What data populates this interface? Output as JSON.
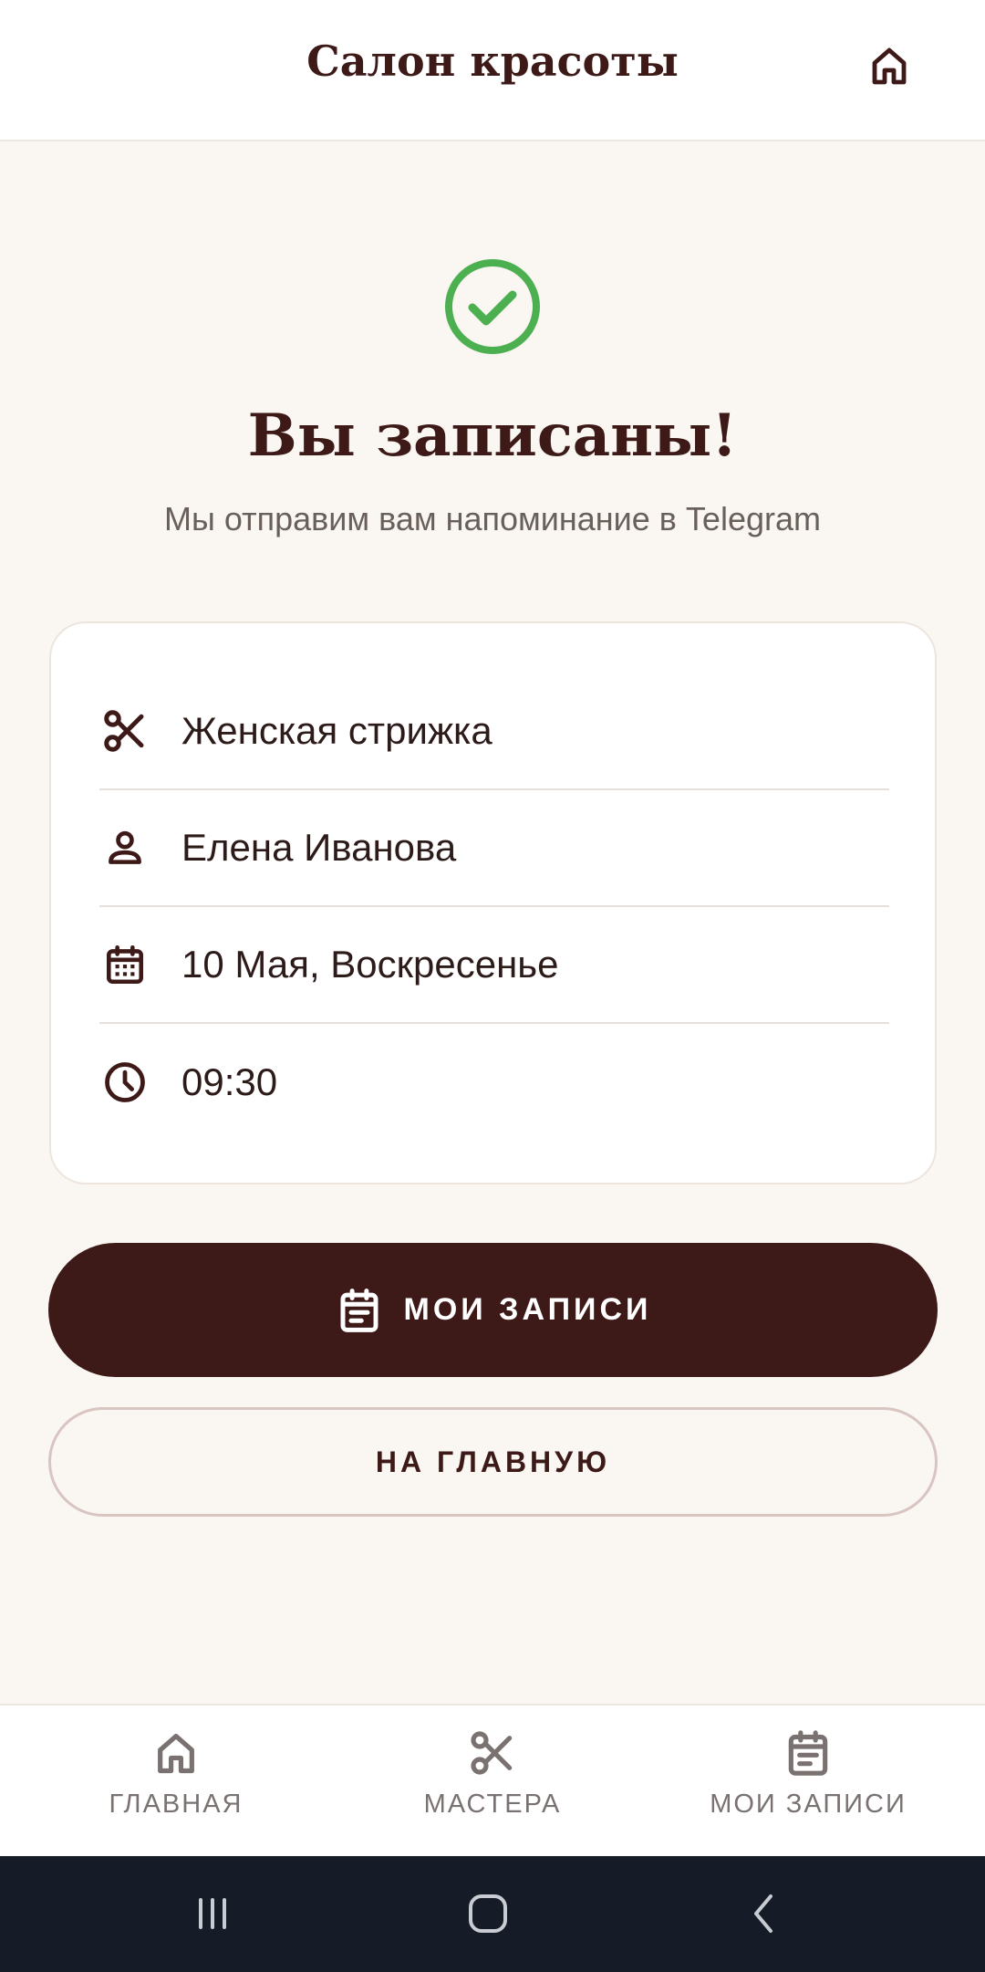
{
  "header": {
    "title": "Салон красоты",
    "home_icon": "home-icon"
  },
  "success": {
    "icon": "check-circle-icon",
    "color": "#4caf50",
    "title": "Вы записаны!",
    "subtitle": "Мы отправим вам напоминание в Telegram"
  },
  "booking": {
    "service": {
      "icon": "scissors-icon",
      "text": "Женская стрижка"
    },
    "master": {
      "icon": "person-icon",
      "text": "Елена Иванова"
    },
    "date": {
      "icon": "calendar-icon",
      "text": "10 Мая, Воскресенье"
    },
    "time": {
      "icon": "clock-icon",
      "text": "09:30"
    }
  },
  "actions": {
    "my_bookings_label": "МОИ ЗАПИСИ",
    "my_bookings_icon": "notes-icon",
    "home_label": "НА ГЛАВНУЮ"
  },
  "bottom_nav": {
    "items": [
      {
        "label": "ГЛАВНАЯ",
        "icon": "home-icon"
      },
      {
        "label": "МАСТЕРА",
        "icon": "scissors-icon"
      },
      {
        "label": "МОИ ЗАПИСИ",
        "icon": "notes-icon"
      }
    ]
  },
  "colors": {
    "primary": "#3d1a18",
    "background": "#faf7f3",
    "success": "#4caf50",
    "system_bar": "#161c27"
  }
}
